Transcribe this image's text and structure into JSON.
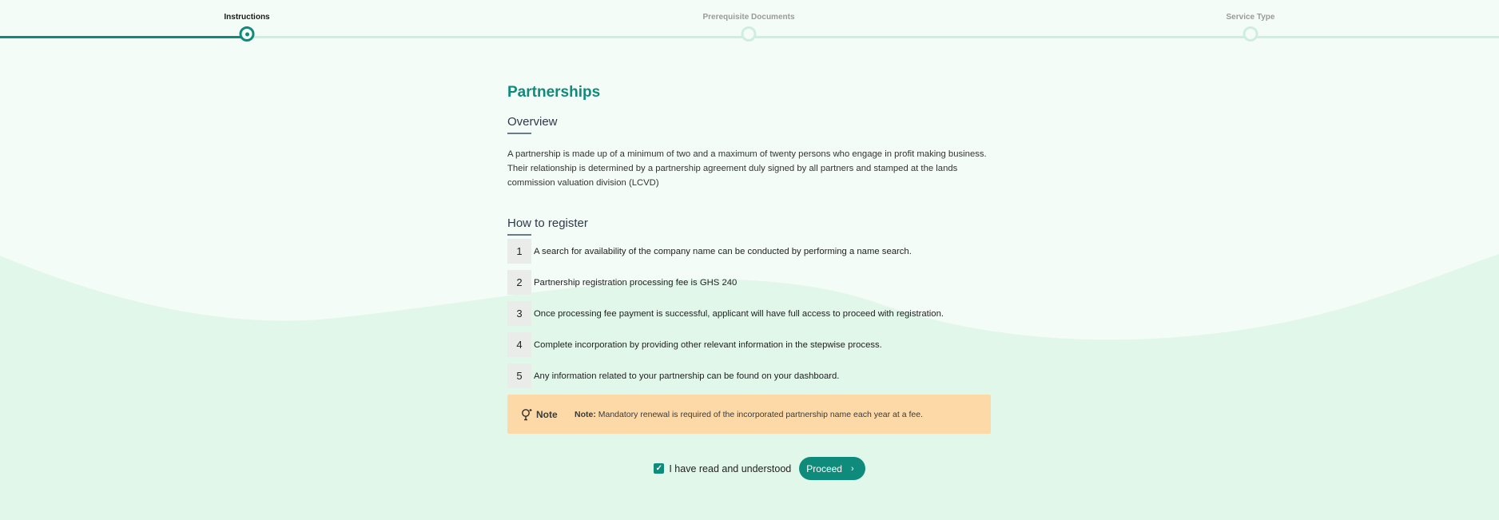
{
  "stepper": {
    "steps": [
      {
        "label": "Instructions",
        "state": "active"
      },
      {
        "label": "Prerequisite Documents",
        "state": "pending"
      },
      {
        "label": "Service Type",
        "state": "pending"
      }
    ]
  },
  "page": {
    "title": "Partnerships",
    "overview_heading": "Overview",
    "overview_text": "A partnership is made up of a minimum of two and a maximum of twenty persons who engage in profit making business. Their relationship is determined by a partnership agreement duly signed by all partners and stamped at the lands commission valuation division (LCVD)",
    "howto_heading": "How to register",
    "steps": [
      {
        "num": "1",
        "text": "A search for availability of the company name can be conducted by performing a name search."
      },
      {
        "num": "2",
        "text": "Partnership registration processing fee is GHS 240"
      },
      {
        "num": "3",
        "text": "Once processing fee payment is successful, applicant will have full access to proceed with registration."
      },
      {
        "num": "4",
        "text": "Complete incorporation by providing other relevant information in the stepwise process."
      },
      {
        "num": "5",
        "text": "Any information related to your partnership can be found on your dashboard."
      }
    ],
    "note": {
      "icon": "lightbulb-icon",
      "label": "Note",
      "prefix": "Note:",
      "text": " Mandatory renewal is required of the incorporated partnership name each year at a fee."
    }
  },
  "actions": {
    "checkbox_checked": true,
    "checkbox_label": "I have read and understood",
    "proceed_label": "Proceed",
    "proceed_icon": "chevron-right-icon"
  },
  "colors": {
    "accent": "#0f8b7b",
    "note_bg": "#fdd9a8",
    "background": "#f4fcf7",
    "wave": "#e1f7e9"
  }
}
